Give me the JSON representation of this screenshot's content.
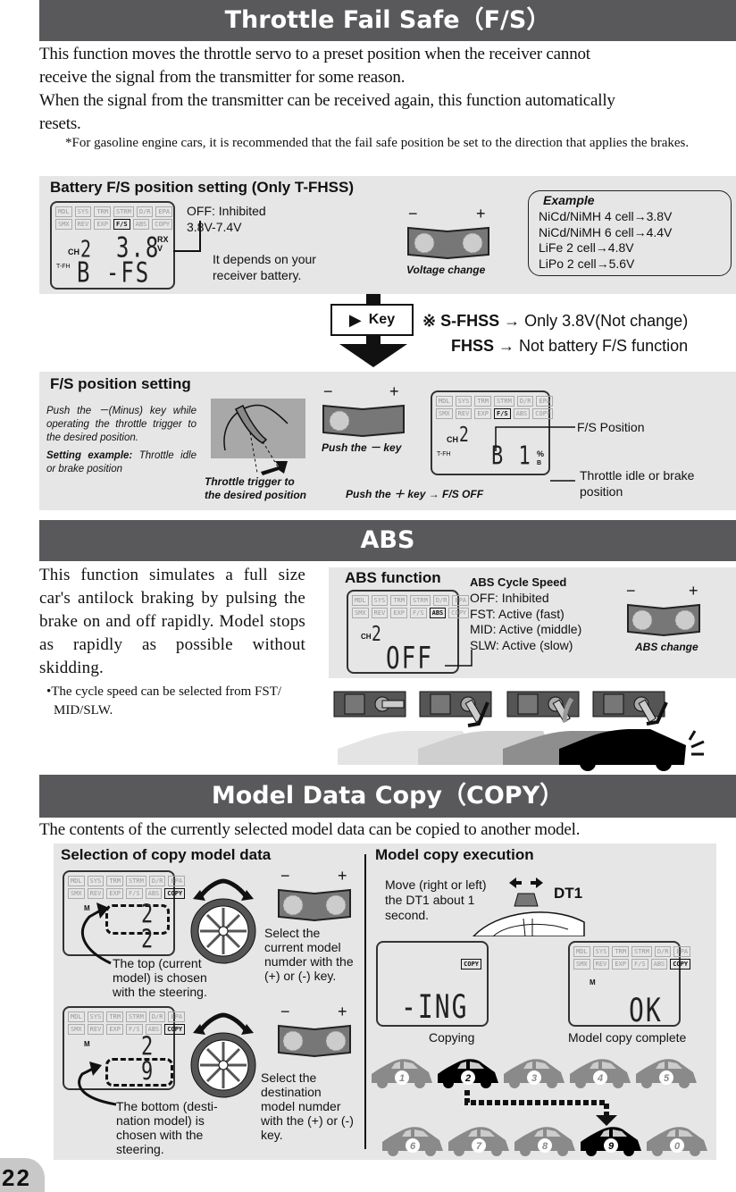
{
  "page_number": "22",
  "fs": {
    "title": "Throttle Fail Safe（F/S）",
    "intro": [
      "This function moves the throttle servo to a preset position when the receiver cannot",
      "receive the signal from the transmitter for some reason.",
      "When the signal from the transmitter can be received again, this function automatically",
      "resets."
    ],
    "note": "*For gasoline engine cars, it is recommended that the fail safe position be set to the direction that applies the brakes.",
    "battery_panel": {
      "title": "Battery F/S position setting (Only T-FHSS)",
      "range_lines": [
        "OFF: Inhibited",
        "3.8V-7.4V"
      ],
      "depends": [
        "It depends on your",
        "receiver battery."
      ],
      "key_caption": "Voltage change",
      "lcd": {
        "top_value": "3.8",
        "unit_top": "RX",
        "unit_bot": "V",
        "ch": "CH",
        "ch_num": "2",
        "mode": "T-FH",
        "bottom": "B -FS"
      },
      "example": {
        "title": "Example",
        "items": [
          "NiCd/NiMH 4 cell→3.8V",
          "NiCd/NiMH 6 cell→4.4V",
          "LiFe 2 cell→4.8V",
          "LiPo 2 cell→5.6V"
        ]
      }
    },
    "key_box": "Key",
    "notes": [
      {
        "bold": "※ S-FHSS",
        "rest": " → Only 3.8V(Not change)"
      },
      {
        "bold": "FHSS",
        "rest": " → Not battery F/S function"
      }
    ],
    "position_panel": {
      "title": "F/S position setting",
      "instruction": "Push the －(Minus) key while operating the throttle trigger to the desired position.",
      "example_label": "Setting example:",
      "example_text": " Throttle idle or brake position",
      "trigger_caption": [
        "Throttle trigger to",
        "the desired position"
      ],
      "push_minus": "Push the － key",
      "push_plus": "Push the ＋ key → F/S OFF",
      "lcd": {
        "ch": "CH",
        "ch_num": "2",
        "mode": "T-FH",
        "value": "B 1",
        "unit": "%",
        "sub": "B"
      },
      "fs_position_label": "F/S Position",
      "idle_label": [
        "Throttle idle or brake",
        "position"
      ]
    }
  },
  "lcd_tags": {
    "row1": [
      "MDL",
      "SYS",
      "TRM",
      "STRM",
      "D/R",
      "EPA"
    ],
    "row2": [
      "SMX",
      "REV",
      "EXP",
      "F/S",
      "ABS",
      "COPY"
    ]
  },
  "abs": {
    "title": "ABS",
    "desc": "This function simulates a full size car's antilock braking by pulsing the brake on and off rapidly. Model stops as rapidly as possible without skidding.",
    "bullet": "•The cycle speed can be selected from FST/ MID/SLW.",
    "panel_title": "ABS function",
    "lcd": {
      "ch": "CH",
      "ch_num": "2",
      "value": "OFF"
    },
    "speed_title": "ABS Cycle Speed",
    "speed_items": [
      "OFF: Inhibited",
      "FST: Active (fast)",
      "MID: Active (middle)",
      "SLW: Active (slow)"
    ],
    "key_caption": "ABS change"
  },
  "copy": {
    "title": "Model Data Copy（COPY）",
    "intro": "The contents of the currently selected model data can be copied to another model.",
    "selection": {
      "title": "Selection of copy model data",
      "top_caption": [
        "The top (current",
        "model) is chosen",
        "with the steering."
      ],
      "top_key_caption": [
        "Select the",
        "current model",
        "numder with the",
        "(+) or (-) key."
      ],
      "bottom_caption": [
        "The bottom (desti-",
        "nation model) is",
        "chosen with the",
        "steering."
      ],
      "bottom_key_caption": [
        "Select the",
        "destination",
        "model numder",
        "with the (+) or (-)",
        "key."
      ],
      "lcd_top": {
        "m": "M",
        "top": "2",
        "bottom": "2"
      },
      "lcd_bottom": {
        "m": "M",
        "top": "2",
        "bottom": "9"
      }
    },
    "execution": {
      "title": "Model copy execution",
      "instruction": [
        "Move (right or left)",
        "the DT1 about 1",
        "second."
      ],
      "dial_label": "DT1",
      "copying_value": "-ING",
      "copying_caption": "Copying",
      "complete_value": "OK",
      "complete_m": "M",
      "complete_caption": "Model copy complete",
      "cars_row1": [
        "1",
        "2",
        "3",
        "4",
        "5"
      ],
      "cars_row2": [
        "6",
        "7",
        "8",
        "9",
        "0"
      ],
      "source": "2",
      "destination": "9"
    }
  },
  "colors": {
    "band": "#59585a",
    "panel": "#e6e6e6",
    "inactive_car": "#8a8a8a",
    "active_car": "#000000"
  }
}
